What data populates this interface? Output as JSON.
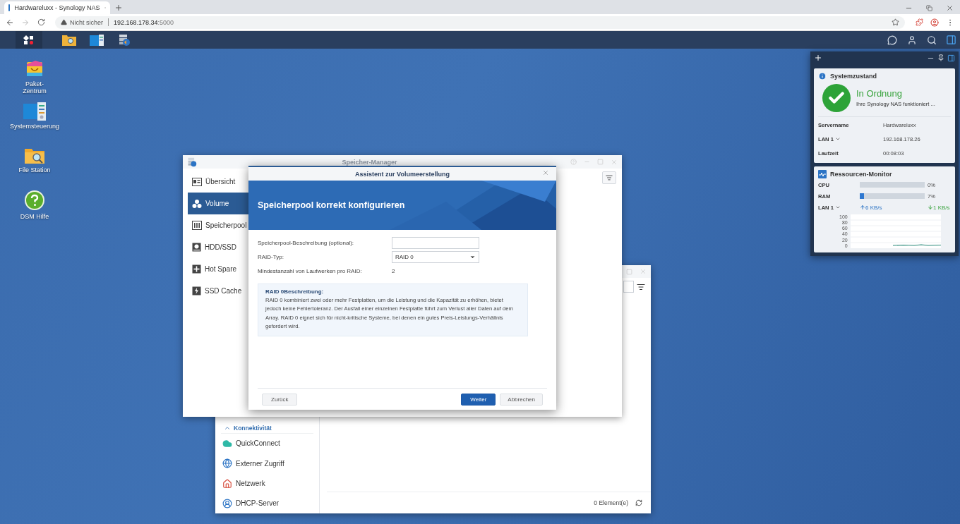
{
  "browser": {
    "tab_title": "Hardwareluxx - Synology NAS",
    "security": "Nicht sicher",
    "host": "192.168.178.34",
    "port": ":5000"
  },
  "desktop_icons": [
    {
      "kind": "package",
      "label": "Paket-\nZentrum"
    },
    {
      "kind": "control",
      "label": "Systemsteuerung"
    },
    {
      "kind": "folder",
      "label": "File Station"
    },
    {
      "kind": "help",
      "label": "DSM Hilfe"
    }
  ],
  "storage_manager": {
    "title": "Speicher-Manager",
    "nav": [
      {
        "label": "Übersicht",
        "selected": false
      },
      {
        "label": "Volume",
        "selected": true
      },
      {
        "label": "Speicherpool",
        "selected": false
      },
      {
        "label": "HDD/SSD",
        "selected": false
      },
      {
        "label": "Hot Spare",
        "selected": false
      },
      {
        "label": "SSD Cache",
        "selected": false
      }
    ]
  },
  "dialog": {
    "title": "Assistent zur Volumeerstellung",
    "heading": "Speicherpool korrekt konfigurieren",
    "fields": [
      {
        "kind": "text",
        "label": "Speicherpool-Beschreibung (optional):"
      },
      {
        "kind": "select",
        "label": "RAID-Typ:",
        "value": "RAID 0"
      },
      {
        "kind": "static",
        "label": "Mindestanzahl von Laufwerken pro RAID:",
        "value": "2"
      }
    ],
    "description": {
      "title": "RAID 0Beschreibung:",
      "text": "RAID 0 kombiniert zwei oder mehr Festplatten, um die Leistung und die Kapazität zu erhöhen, bietet jedoch keine Fehlertoleranz. Der Ausfall einer einzelnen Festplatte führt zum Verlust aller Daten auf dem Array. RAID 0 eignet sich für nicht-kritische Systeme, bei denen ein gutes Preis-Leistungs-Verhältnis gefordert wird."
    },
    "back_button": "Zurück",
    "next_button": "Weiter",
    "cancel_button": "Abbrechen"
  },
  "control_panel": {
    "section": {
      "label": "Konnektivität",
      "expanded": true,
      "items": [
        "QuickConnect",
        "Externer Zugriff",
        "Netzwerk",
        "DHCP-Server"
      ]
    },
    "footer": "0 Element(e)"
  },
  "widgets": {
    "system": {
      "title": "Systemzustand",
      "status": "In Ordnung",
      "message": "Ihre Synology NAS funktioniert ...",
      "rows": [
        {
          "label": "Servername",
          "value": "Hardwareluxx",
          "dropdown": false
        },
        {
          "label": "LAN 1",
          "value": "192.168.178.26",
          "dropdown": true
        },
        {
          "label": "Laufzeit",
          "value": "00:08:03",
          "dropdown": false
        }
      ]
    },
    "resources": {
      "title": "Ressourcen-Monitor",
      "meters": [
        {
          "label": "CPU",
          "level": 0,
          "reading": "0%"
        },
        {
          "label": "RAM",
          "level": 0.07,
          "reading": "7%"
        }
      ],
      "lan": {
        "label": "LAN 1",
        "upload": "6 KB/s",
        "download": "1 KB/s"
      },
      "axis_labels": [
        "100",
        "80",
        "60",
        "40",
        "20",
        "0"
      ]
    }
  }
}
